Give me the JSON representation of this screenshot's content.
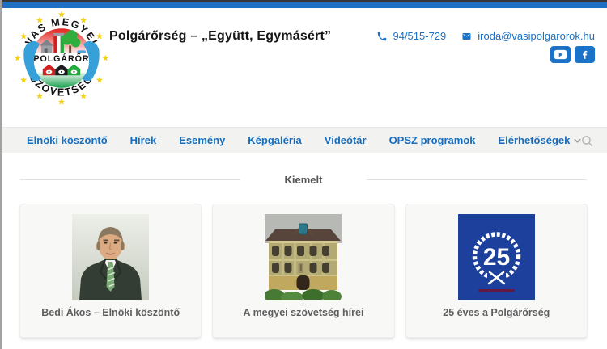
{
  "header": {
    "title": "Polgárőrség – „Együtt, Egymásért”",
    "phone": "94/515-729",
    "email": "iroda@vasipolgarorok.hu",
    "logo": {
      "top_arc": "VAS MEGYEI",
      "band": "POLGÁRŐR",
      "bottom_arc": "SZÖVETSÉG"
    },
    "icons": [
      "phone-icon",
      "envelope-icon",
      "youtube-icon",
      "facebook-icon"
    ]
  },
  "nav": {
    "items": [
      {
        "label": "Elnöki köszöntő"
      },
      {
        "label": "Hírek"
      },
      {
        "label": "Esemény"
      },
      {
        "label": "Képgaléria"
      },
      {
        "label": "Videótár"
      },
      {
        "label": "OPSZ programok"
      },
      {
        "label": "Elérhetőségek",
        "dropdown": true
      }
    ],
    "search_icon": "search-icon"
  },
  "main": {
    "section_title": "Kiemelt",
    "cards": [
      {
        "caption": "Bedi Ákos – Elnöki köszöntő",
        "image": "portrait-bedi-akos"
      },
      {
        "caption": "A megyei szövetség hírei",
        "image": "county-hall-building"
      },
      {
        "caption": "25 éves a Polgárőrség",
        "image": "anniversary-wreath",
        "wreath_number": "25"
      }
    ]
  },
  "colors": {
    "accent_blue": "#1f6fc2",
    "link_blue": "#176dbd",
    "social_blue": "#1a73c8",
    "nav_bg": "#f2f2f1",
    "card_bg": "#f8f8f7",
    "anniversary_blue": "#1d409c"
  }
}
